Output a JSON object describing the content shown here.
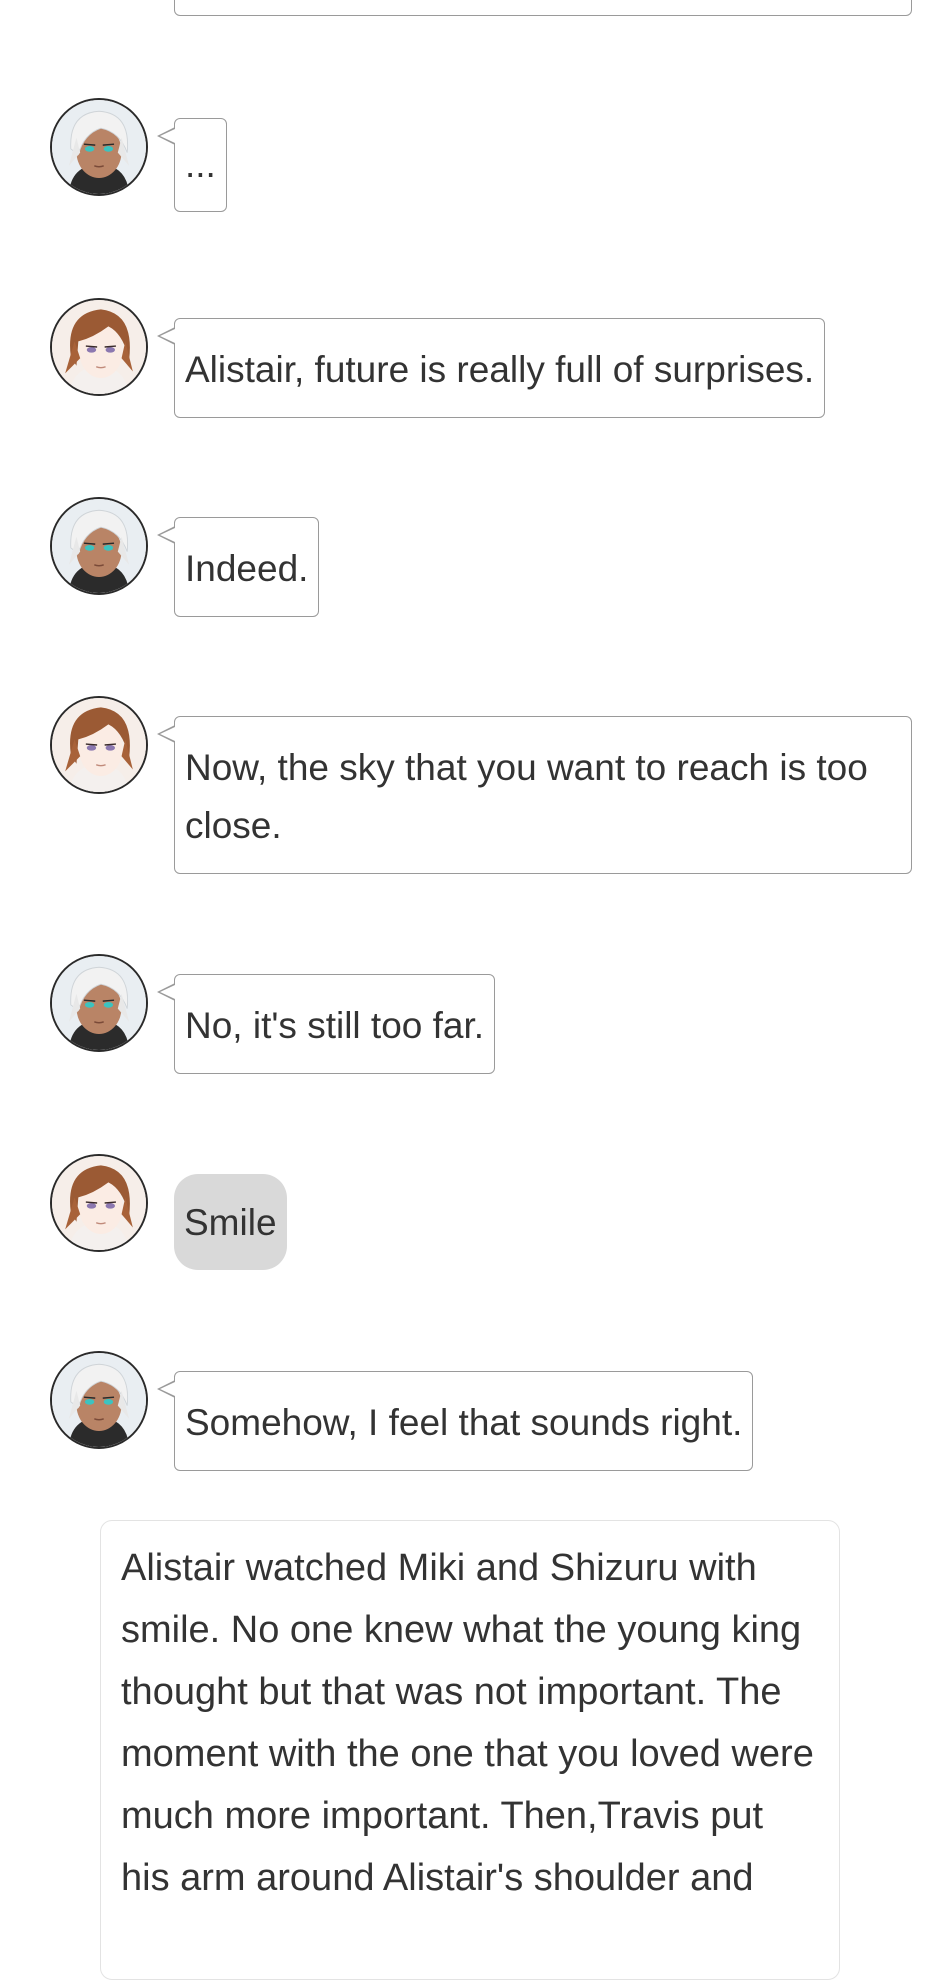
{
  "characters": {
    "alistair": {
      "name": "Alistair",
      "avatar_icon": "white-haired-character-avatar-icon"
    },
    "brown": {
      "avatar_icon": "brown-haired-character-avatar-icon"
    }
  },
  "messages": [
    {
      "speaker": "alistair",
      "kind": "speech",
      "text": "..."
    },
    {
      "speaker": "brown",
      "kind": "speech",
      "text": "Alistair, future is really full of surprises."
    },
    {
      "speaker": "alistair",
      "kind": "speech",
      "text": "Indeed."
    },
    {
      "speaker": "brown",
      "kind": "speech",
      "text": "Now, the sky that you want to reach is too close."
    },
    {
      "speaker": "alistair",
      "kind": "speech",
      "text": "No, it's still too far."
    },
    {
      "speaker": "brown",
      "kind": "action",
      "text": "Smile"
    },
    {
      "speaker": "alistair",
      "kind": "speech",
      "text": "Somehow, I feel that sounds right."
    }
  ],
  "narration": {
    "text": "Alistair watched Miki and Shizuru with smile. No one knew what the young king thought but that was not important. The moment with the one that you loved were much more important. Then,Travis put his arm around Alistair's shoulder and"
  },
  "colors": {
    "bubble_border": "#9a9a9a",
    "action_bubble_bg": "#d9d9d9",
    "text": "#333333",
    "narration_border": "#e3e3e3"
  }
}
